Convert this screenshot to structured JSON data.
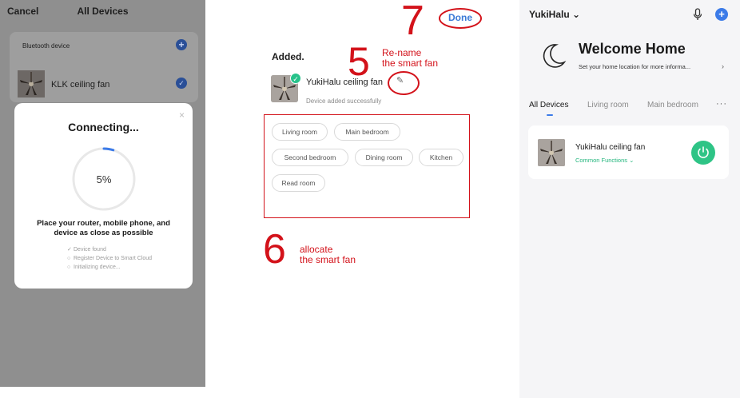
{
  "panel1": {
    "cancel": "Cancel",
    "title": "All Devices",
    "bluetooth_label": "Bluetooth device",
    "device_name": "KLK ceiling fan",
    "modal": {
      "close": "×",
      "heading": "Connecting...",
      "progress_text": "5%",
      "progress_fraction": 0.05,
      "message_line1": "Place your router, mobile phone, and",
      "message_line2": "device as close as possible",
      "steps": [
        {
          "mark": "✓",
          "text": "Device found"
        },
        {
          "mark": "○",
          "text": "Register Device to Smart Cloud"
        },
        {
          "mark": "○",
          "text": "Initializing device..."
        }
      ]
    }
  },
  "panel2": {
    "done": "Done",
    "added": "Added.",
    "device_name": "YukiHalu ceiling fan",
    "device_sub": "Device added successfully",
    "rooms": [
      "Living room",
      "Main bedroom",
      "Second bedroom",
      "Dining room",
      "Kitchen",
      "Read room"
    ],
    "annotations": {
      "step5": {
        "num": "5",
        "line1": "Re-name",
        "line2": "the smart fan"
      },
      "step6": {
        "num": "6",
        "line1": "allocate",
        "line2": "the smart fan"
      },
      "step7": {
        "num": "7"
      }
    },
    "colors": {
      "annotation": "#d3121a",
      "done": "#3b7ad6"
    }
  },
  "panel3": {
    "home_name": "YukiHalu",
    "welcome": "Welcome Home",
    "location_prompt": "Set your home location for more informa...",
    "tabs": [
      "All Devices",
      "Living room",
      "Main bedroom"
    ],
    "more": "···",
    "device_name": "YukiHalu ceiling fan",
    "common_functions": "Common Functions",
    "colors": {
      "accent": "#3c7be8",
      "power": "#2ec486"
    }
  }
}
